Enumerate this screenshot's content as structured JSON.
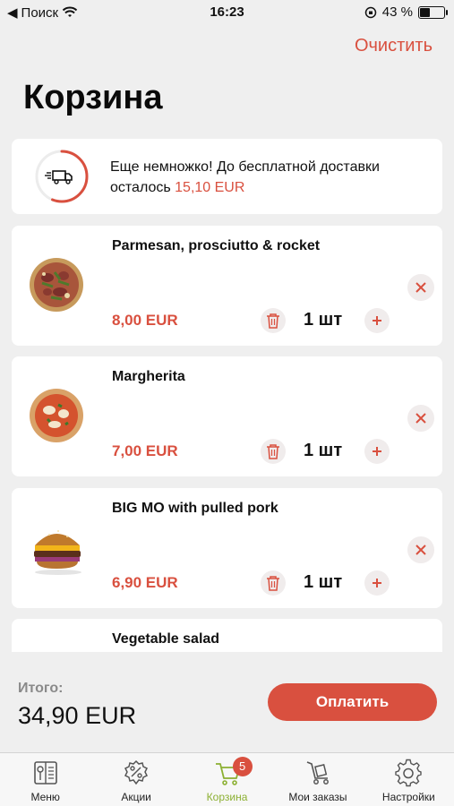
{
  "status_bar": {
    "back_label": "Поиск",
    "time": "16:23",
    "battery": "43 %",
    "battery_level": 0.43
  },
  "header": {
    "clear_label": "Очистить",
    "title": "Корзина"
  },
  "delivery": {
    "message": "Еще немножко! До бесплатной доставки осталось ",
    "amount": "15,10 EUR",
    "progress": 0.56
  },
  "items": [
    {
      "name": "Parmesan, prosciutto & rocket",
      "price": "8,00 EUR",
      "qty": "1 шт",
      "image": "pizza-prosciutto-image"
    },
    {
      "name": "Margherita",
      "price": "7,00 EUR",
      "qty": "1 шт",
      "image": "pizza-margherita-image"
    },
    {
      "name": "BIG MO with pulled pork",
      "price": "6,90 EUR",
      "qty": "1 шт",
      "image": "burger-image"
    },
    {
      "name": "Vegetable salad",
      "price": "",
      "qty": "",
      "image": ""
    }
  ],
  "total": {
    "label": "Итого:",
    "value": "34,90 EUR",
    "pay_label": "Оплатить"
  },
  "tabs": [
    {
      "label": "Меню",
      "icon": "menu-book-icon"
    },
    {
      "label": "Акции",
      "icon": "discount-icon"
    },
    {
      "label": "Корзина",
      "icon": "cart-icon",
      "badge": "5",
      "active": true
    },
    {
      "label": "Мои заказы",
      "icon": "orders-trolley-icon"
    },
    {
      "label": "Настройки",
      "icon": "gear-icon"
    }
  ],
  "colors": {
    "accent": "#d9503f",
    "active_tab": "#8cb032"
  }
}
